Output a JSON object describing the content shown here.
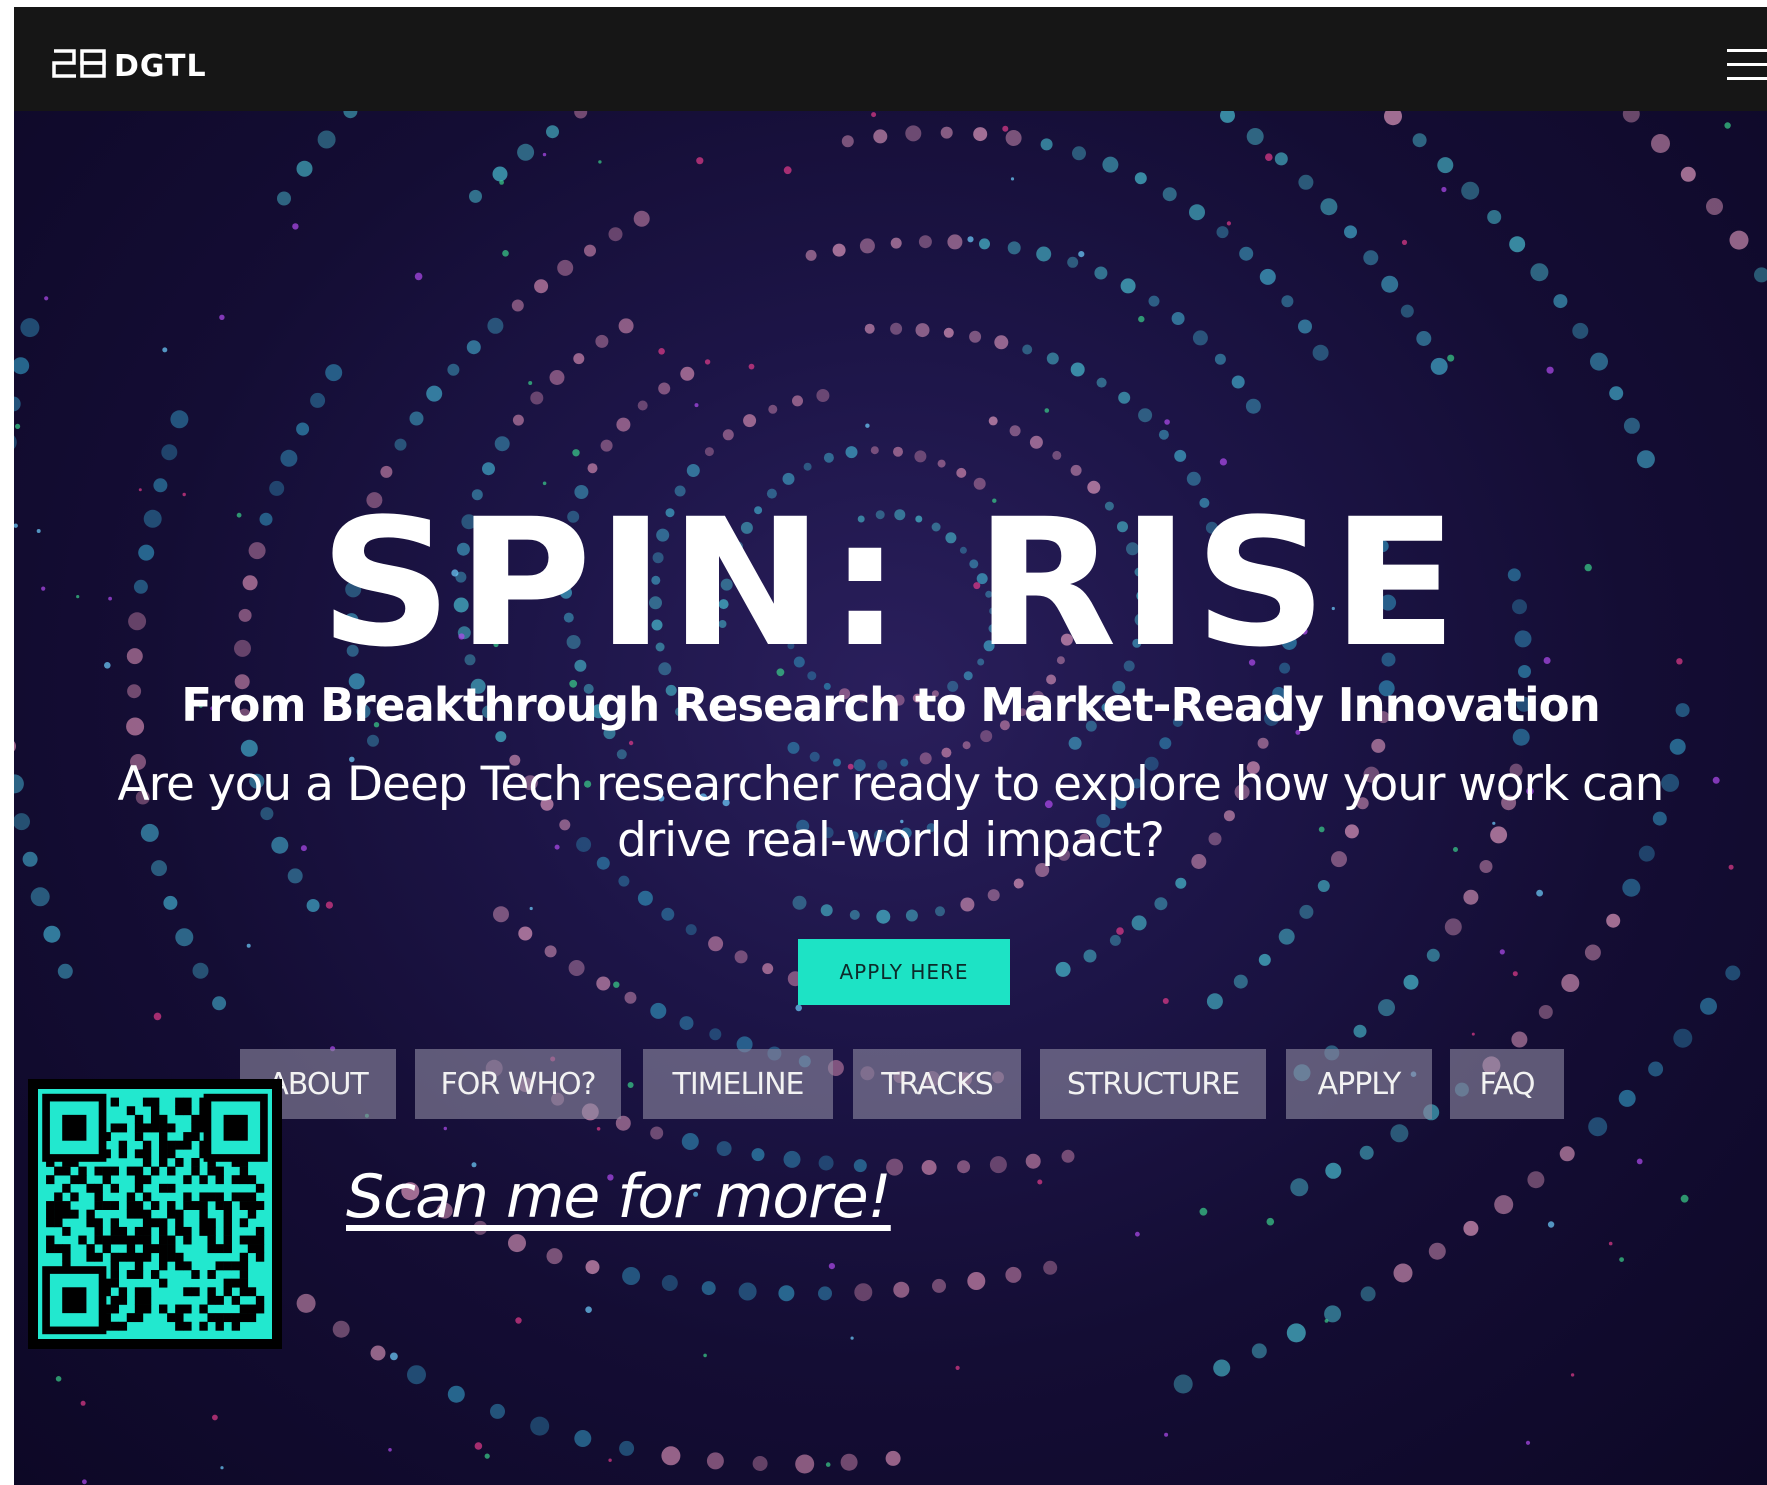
{
  "header": {
    "logo_text": "DGTL",
    "logo_mark": "28-logo-mark",
    "menu_icon": "hamburger-menu-icon"
  },
  "hero": {
    "title": "SPIN: RISE",
    "subtitle": "From Breakthrough Research to Market-Ready Innovation",
    "question_line1": "Are you a Deep Tech researcher ready to explore how your work can",
    "question_line2": "drive real-world impact?",
    "apply_label": "APPLY HERE",
    "background": "spiral-particle-tunnel"
  },
  "nav": {
    "items": [
      {
        "label": "ABOUT"
      },
      {
        "label": "FOR WHO?"
      },
      {
        "label": "TIMELINE"
      },
      {
        "label": "TRACKS"
      },
      {
        "label": "STRUCTURE"
      },
      {
        "label": "APPLY"
      },
      {
        "label": "FAQ"
      }
    ]
  },
  "qr": {
    "icon": "qr-code-icon",
    "link_text": "Scan me for more!"
  },
  "colors": {
    "accent": "#1de3c5",
    "topbar": "#161616",
    "background": "#12092e",
    "qr_fill": "#22e8cf"
  }
}
